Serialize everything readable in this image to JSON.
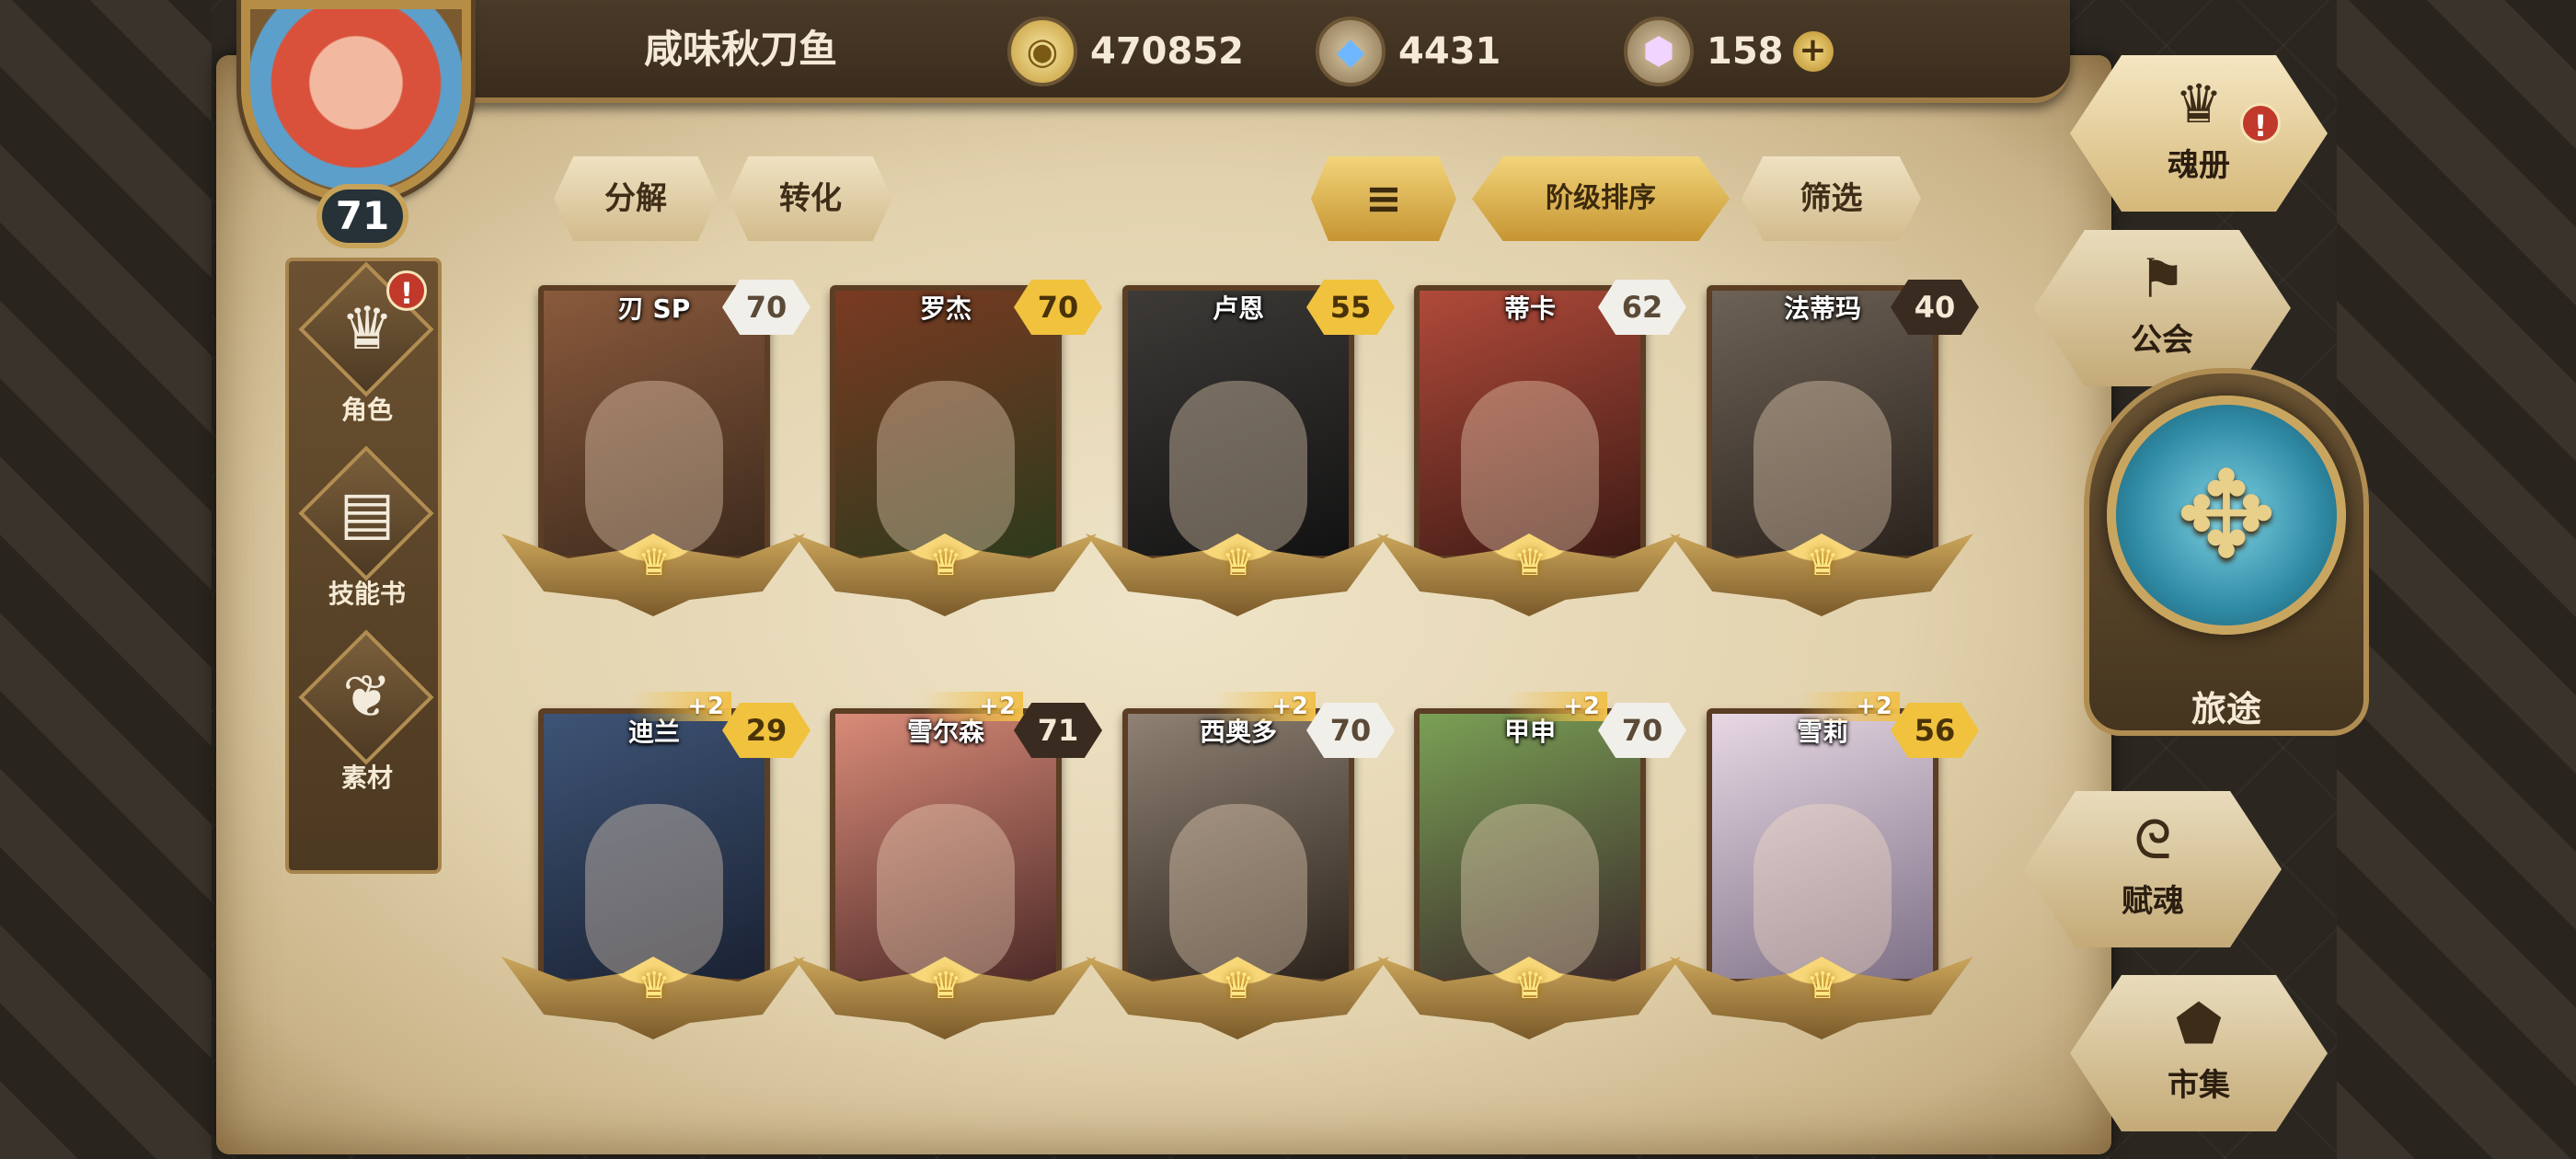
{
  "header": {
    "player_name": "咸味秋刀鱼",
    "level": "71",
    "resources": {
      "gold": "470852",
      "crystal": "4431",
      "gem": "158"
    },
    "plus_glyph": "+"
  },
  "left_nav": [
    {
      "label": "角色",
      "icon": "character-icon",
      "alert": "!"
    },
    {
      "label": "技能书",
      "icon": "skill-book-icon"
    },
    {
      "label": "素材",
      "icon": "materials-icon"
    }
  ],
  "toolbar": {
    "dismantle": "分解",
    "convert": "转化",
    "sort_dir_glyph": "≡",
    "rank_sort": "阶级排序",
    "filter": "筛选"
  },
  "heroes": [
    {
      "name": "刃 SP",
      "level": "70",
      "badge": "white",
      "colors": [
        "#8a5a3c",
        "#3d2a1d"
      ]
    },
    {
      "name": "罗杰",
      "level": "70",
      "badge": "gold",
      "colors": [
        "#7a3a22",
        "#2e3a1c"
      ]
    },
    {
      "name": "卢恩",
      "level": "55",
      "badge": "gold",
      "colors": [
        "#3d3a37",
        "#121212"
      ]
    },
    {
      "name": "蒂卡",
      "level": "62",
      "badge": "white",
      "colors": [
        "#b04a3a",
        "#3d1a14"
      ]
    },
    {
      "name": "法蒂玛",
      "level": "40",
      "badge": "dark",
      "colors": [
        "#6d6256",
        "#2a221c"
      ]
    },
    {
      "name": "迪兰",
      "level": "29",
      "badge": "gold",
      "bonus": "+2",
      "colors": [
        "#3e5476",
        "#1a2233"
      ]
    },
    {
      "name": "雪尔森",
      "level": "71",
      "badge": "dark",
      "bonus": "+2",
      "colors": [
        "#d98b78",
        "#4e2a28"
      ]
    },
    {
      "name": "西奥多",
      "level": "70",
      "badge": "white",
      "bonus": "+2",
      "colors": [
        "#8f8173",
        "#2c241d"
      ]
    },
    {
      "name": "甲申",
      "level": "70",
      "badge": "white",
      "bonus": "+2",
      "colors": [
        "#7aa055",
        "#3b2a2a"
      ]
    },
    {
      "name": "雪莉",
      "level": "56",
      "badge": "gold",
      "bonus": "+2",
      "colors": [
        "#e8d8e4",
        "#7e7086"
      ]
    }
  ],
  "right_nav": {
    "soulbook": {
      "label": "魂册",
      "alert": "!"
    },
    "guild": {
      "label": "公会"
    },
    "journey": {
      "label": "旅途"
    },
    "enchant": {
      "label": "赋魂"
    },
    "market": {
      "label": "市集"
    }
  }
}
